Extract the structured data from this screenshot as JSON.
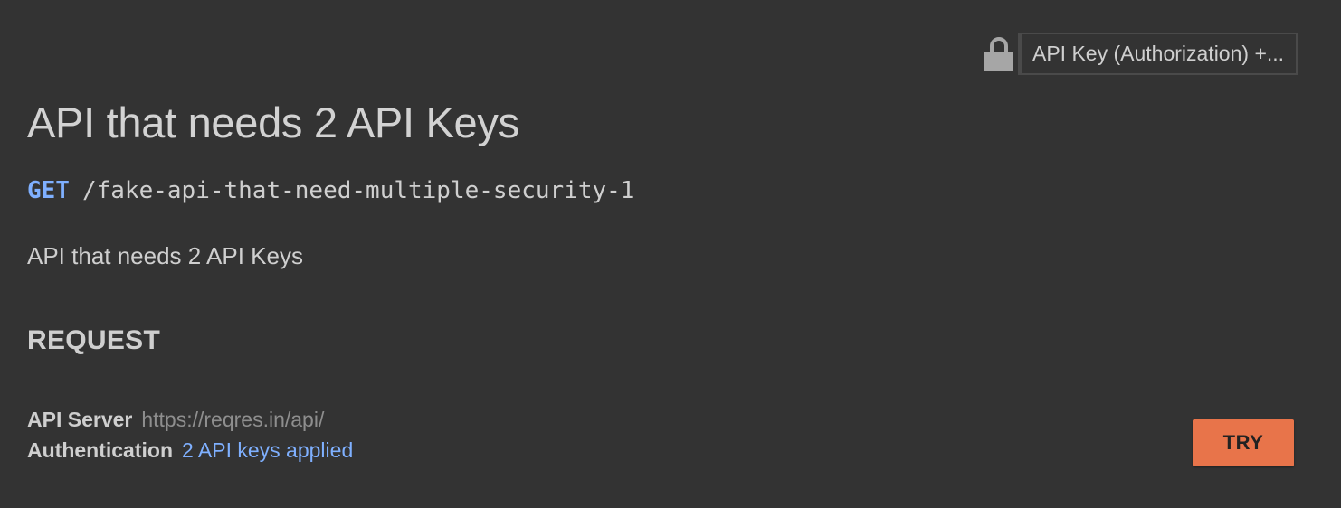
{
  "security": {
    "selected": "API Key (Authorization) +...",
    "icon": "lock-icon"
  },
  "operation": {
    "title": "API that needs 2 API Keys",
    "method": "GET",
    "path": "/fake-api-that-need-multiple-security-1",
    "description": "API that needs 2 API Keys"
  },
  "request": {
    "heading": "REQUEST",
    "server_label": "API Server",
    "server_url": "https://reqres.in/api/",
    "auth_label": "Authentication",
    "auth_value": "2 API keys applied",
    "try_label": "TRY"
  },
  "colors": {
    "background": "#333333",
    "method": "#7fb0ff",
    "link": "#7fb0ff",
    "try_button": "#e8744a"
  }
}
